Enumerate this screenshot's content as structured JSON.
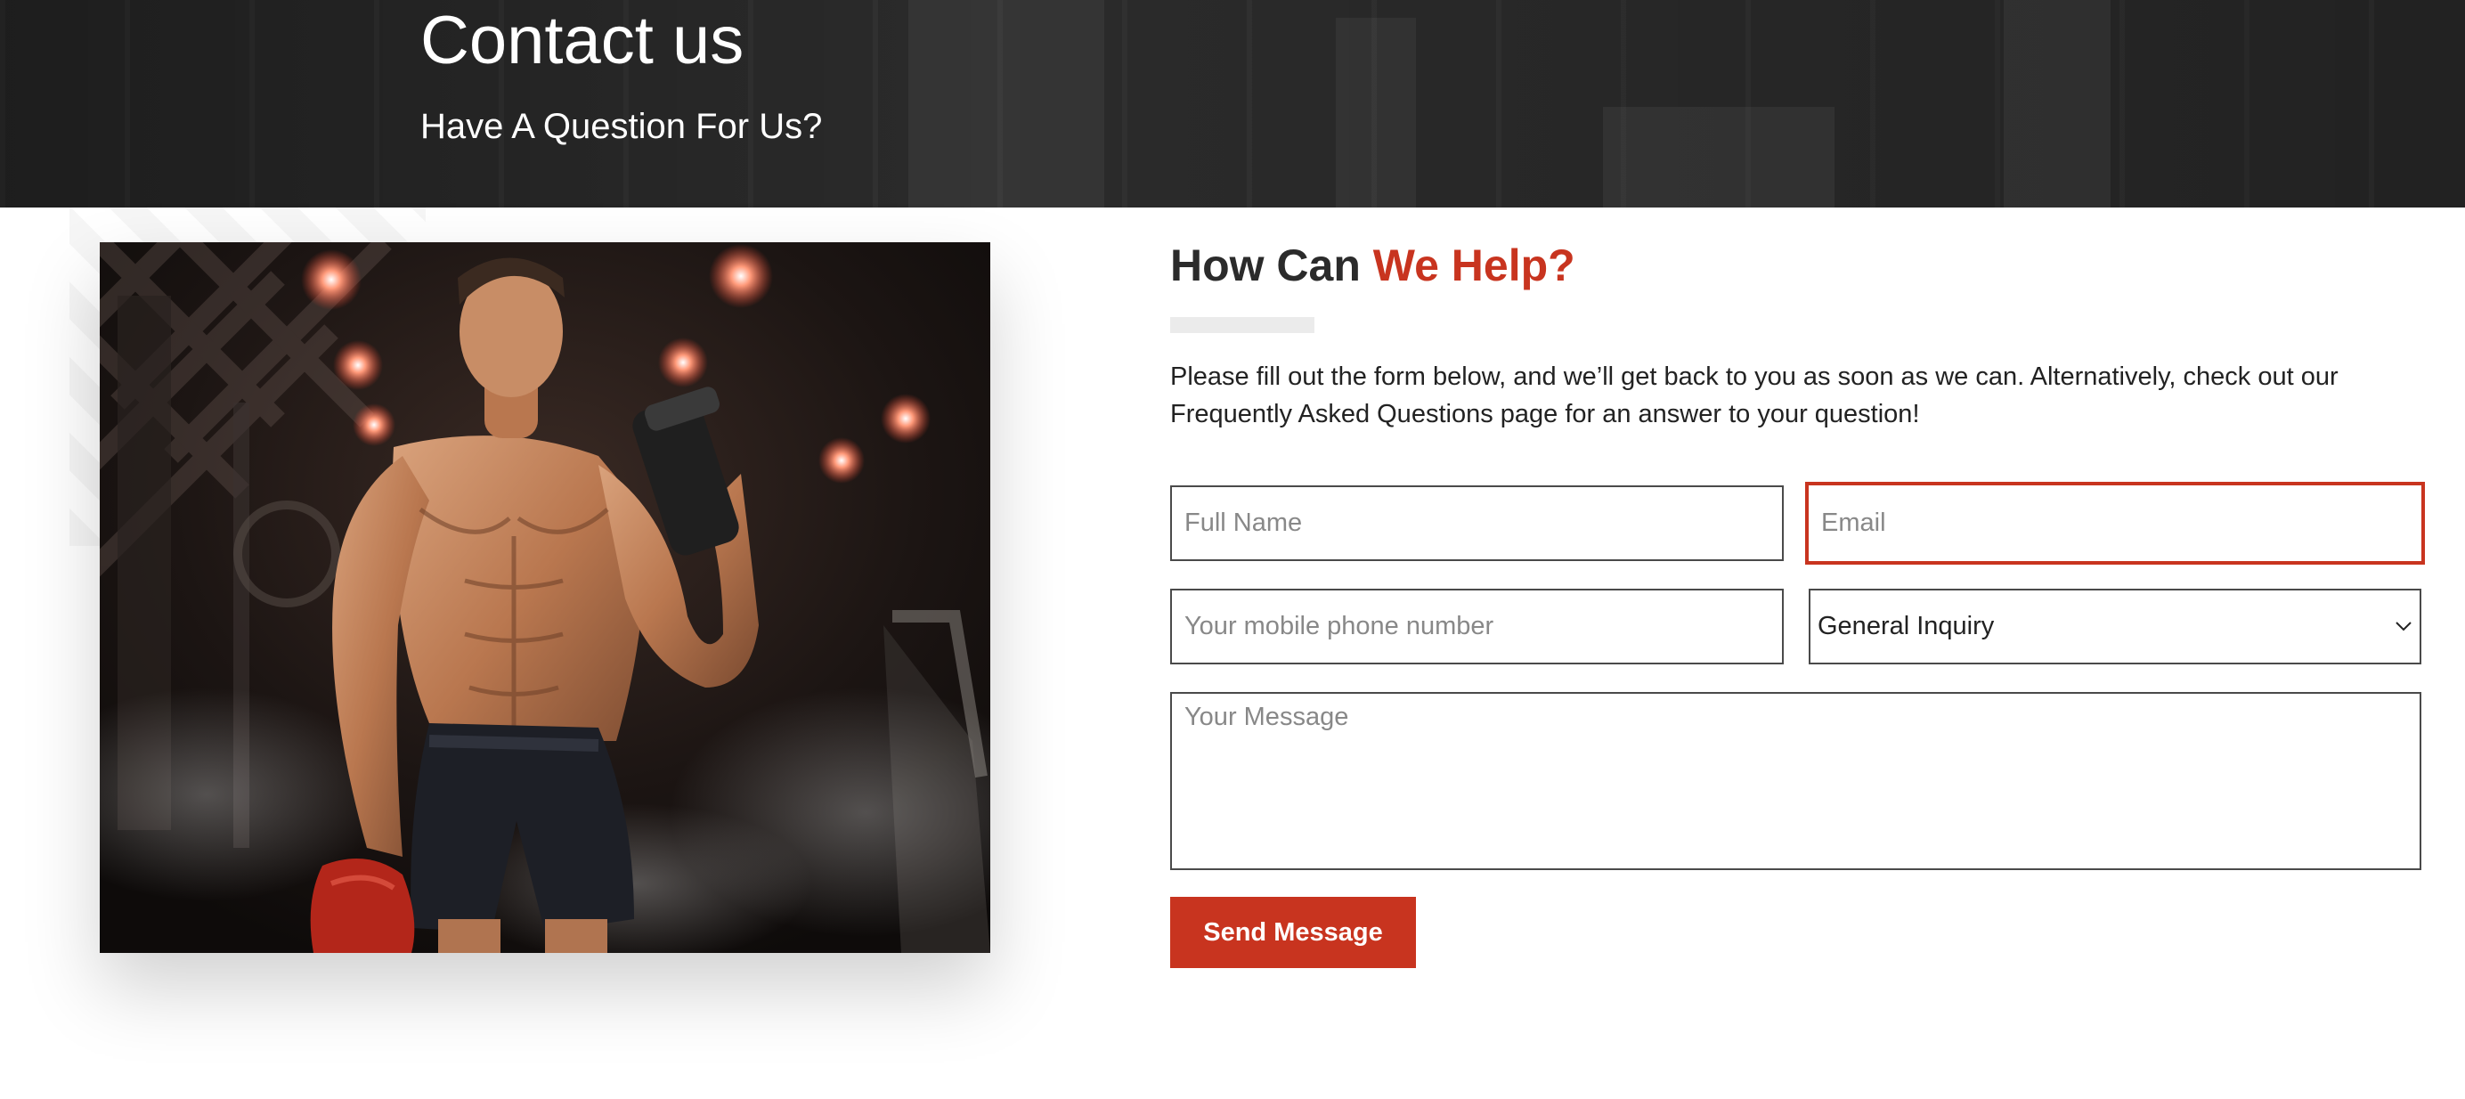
{
  "hero": {
    "title": "Contact us",
    "subtitle": "Have A Question For Us?"
  },
  "form_section": {
    "title_prefix": "How Can ",
    "title_accent": "We Help?",
    "intro": "Please fill out the form below, and we’ll get back to you as soon as we can. Alternatively, check out our Frequently Asked Questions page for an answer to your question!",
    "fields": {
      "full_name": {
        "placeholder": "Full Name",
        "value": ""
      },
      "email": {
        "placeholder": "Email",
        "value": ""
      },
      "phone": {
        "placeholder": "Your mobile phone number",
        "value": ""
      },
      "inquiry_type": {
        "selected": "General Inquiry"
      },
      "message": {
        "placeholder": "Your Message",
        "value": ""
      }
    },
    "submit_label": "Send Message"
  },
  "colors": {
    "accent": "#c8341f",
    "hero_bg": "#2b2b2b",
    "text": "#222222"
  },
  "icons": {
    "select_chevron": "chevron-down-icon"
  }
}
